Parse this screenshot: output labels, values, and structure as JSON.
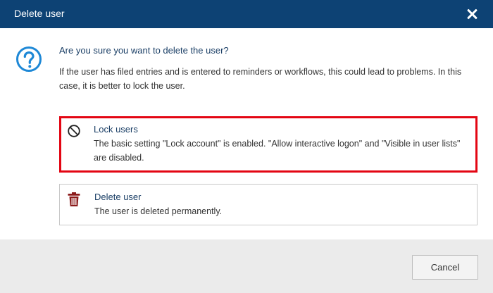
{
  "dialog": {
    "title": "Delete user",
    "question": "Are you sure you want to delete the user?",
    "description": "If the user has filed entries and is entered to reminders or workflows, this could lead to problems. In this case, it is better to lock the user."
  },
  "options": [
    {
      "title": "Lock users",
      "text": "The basic setting \"Lock account\" is enabled. \"Allow interactive logon\" and \"Visible in user lists\" are disabled.",
      "icon": "prohibited-icon",
      "highlighted": true,
      "border_color": "#e30613"
    },
    {
      "title": "Delete user",
      "text": "The user is deleted permanently.",
      "icon": "trash-icon",
      "icon_color": "#8b1a1a"
    }
  ],
  "footer": {
    "cancel_label": "Cancel"
  },
  "colors": {
    "titlebar": "#0d4274",
    "accent": "#1e88d6",
    "heading_text": "#1b3f66",
    "footer_bg": "#ebebeb"
  }
}
